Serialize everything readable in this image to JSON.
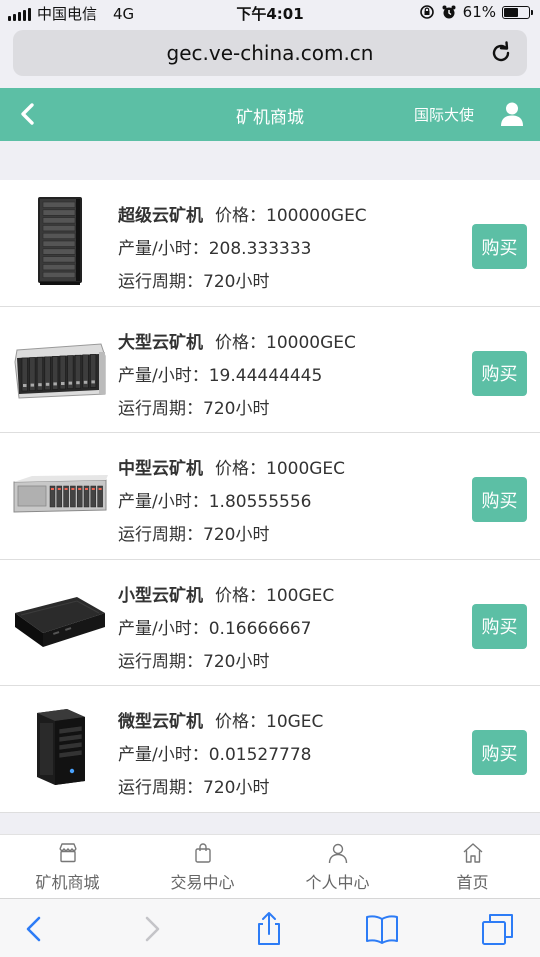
{
  "status_bar": {
    "carrier": "中国电信",
    "network": "4G",
    "time": "下午4:01",
    "battery": "61%",
    "battery_level": 0.61
  },
  "browser": {
    "url": "gec.ve-china.com.cn"
  },
  "header": {
    "title": "矿机商城",
    "ambassador_label": "国际大使"
  },
  "labels": {
    "price": "价格：",
    "output": "产量/小时：",
    "period": "运行周期：",
    "buy": "购买"
  },
  "products": [
    {
      "name": "超级云矿机",
      "price": "100000GEC",
      "output": "208.333333",
      "period": "720小时",
      "image": "rack-server"
    },
    {
      "name": "大型云矿机",
      "price": "10000GEC",
      "output": "19.44444445",
      "period": "720小时",
      "image": "blade-server"
    },
    {
      "name": "中型云矿机",
      "price": "1000GEC",
      "output": "1.80555556",
      "period": "720小时",
      "image": "rack-unit-server"
    },
    {
      "name": "小型云矿机",
      "price": "100GEC",
      "output": "0.16666667",
      "period": "720小时",
      "image": "mini-box"
    },
    {
      "name": "微型云矿机",
      "price": "10GEC",
      "output": "0.01527778",
      "period": "720小时",
      "image": "tower-server"
    }
  ],
  "tabbar": [
    {
      "label": "矿机商城",
      "icon": "store-icon"
    },
    {
      "label": "交易中心",
      "icon": "bag-icon"
    },
    {
      "label": "个人中心",
      "icon": "person-icon"
    },
    {
      "label": "首页",
      "icon": "home-icon"
    }
  ],
  "colors": {
    "accent": "#5cbfa5",
    "background": "#efeff4"
  }
}
